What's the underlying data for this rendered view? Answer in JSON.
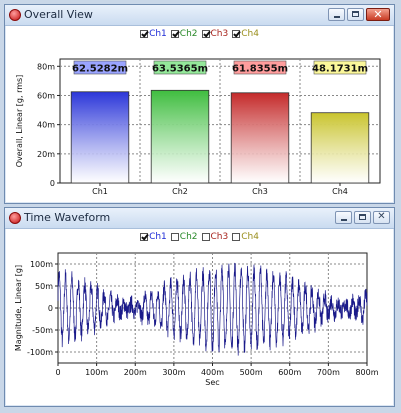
{
  "colors": {
    "ch1": "#2b36d9",
    "ch2": "#3fbd3f",
    "ch3": "#c42a2a",
    "ch4": "#c9c42e",
    "waveform": "#1a1a8a",
    "ch1_label_bg": "#9aa4ff",
    "ch2_label_bg": "#94e89a",
    "ch3_label_bg": "#ff9d9d",
    "ch4_label_bg": "#fbf79a"
  },
  "overall_window": {
    "title": "Overall View",
    "legend": [
      {
        "label": "Ch1",
        "checked": true,
        "color": "#1e2bd6"
      },
      {
        "label": "Ch2",
        "checked": true,
        "color": "#2a8a2a"
      },
      {
        "label": "Ch3",
        "checked": true,
        "color": "#a8261f"
      },
      {
        "label": "Ch4",
        "checked": true,
        "color": "#9a8f1d"
      }
    ]
  },
  "waveform_window": {
    "title": "Time Waveform",
    "legend": [
      {
        "label": "Ch1",
        "checked": true,
        "color": "#1e2bd6"
      },
      {
        "label": "Ch2",
        "checked": false,
        "color": "#2a8a2a"
      },
      {
        "label": "Ch3",
        "checked": false,
        "color": "#a8261f"
      },
      {
        "label": "Ch4",
        "checked": false,
        "color": "#9a8f1d"
      }
    ]
  },
  "chart_data": [
    {
      "type": "bar",
      "categories": [
        "Ch1",
        "Ch2",
        "Ch3",
        "Ch4"
      ],
      "values": [
        0.0625282,
        0.0635365,
        0.0618355,
        0.0481731
      ],
      "data_labels": [
        "62.5282m",
        "63.5365m",
        "61.8355m",
        "48.1731m"
      ],
      "ylabel": "Overall, Linear [g, rms]",
      "xlabel": "",
      "ylim": [
        0,
        0.085
      ],
      "yticks": [
        0,
        0.02,
        0.04,
        0.06,
        0.08
      ],
      "ytick_labels": [
        "0",
        "20m",
        "40m",
        "60m",
        "80m"
      ],
      "grid": true
    },
    {
      "type": "line",
      "series": [
        {
          "name": "Ch1"
        }
      ],
      "xlabel": "Sec",
      "ylabel": "Magnitude, Linear [g]",
      "xlim": [
        0,
        0.8
      ],
      "ylim": [
        -0.125,
        0.125
      ],
      "xticks": [
        0,
        0.1,
        0.2,
        0.3,
        0.4,
        0.5,
        0.6,
        0.7,
        0.8
      ],
      "xtick_labels": [
        "0",
        "100m",
        "200m",
        "300m",
        "400m",
        "500m",
        "600m",
        "700m",
        "800m"
      ],
      "yticks": [
        0.1,
        0.05,
        0,
        -0.05,
        -0.1
      ],
      "ytick_labels": [
        "100m",
        "50m",
        "0",
        "-50m",
        "-100m"
      ],
      "grid": true,
      "signal": {
        "amplitude": 0.09,
        "components_hz": [
          59.5,
          61.3
        ],
        "peak": 0.12,
        "trough": -0.12
      }
    }
  ]
}
